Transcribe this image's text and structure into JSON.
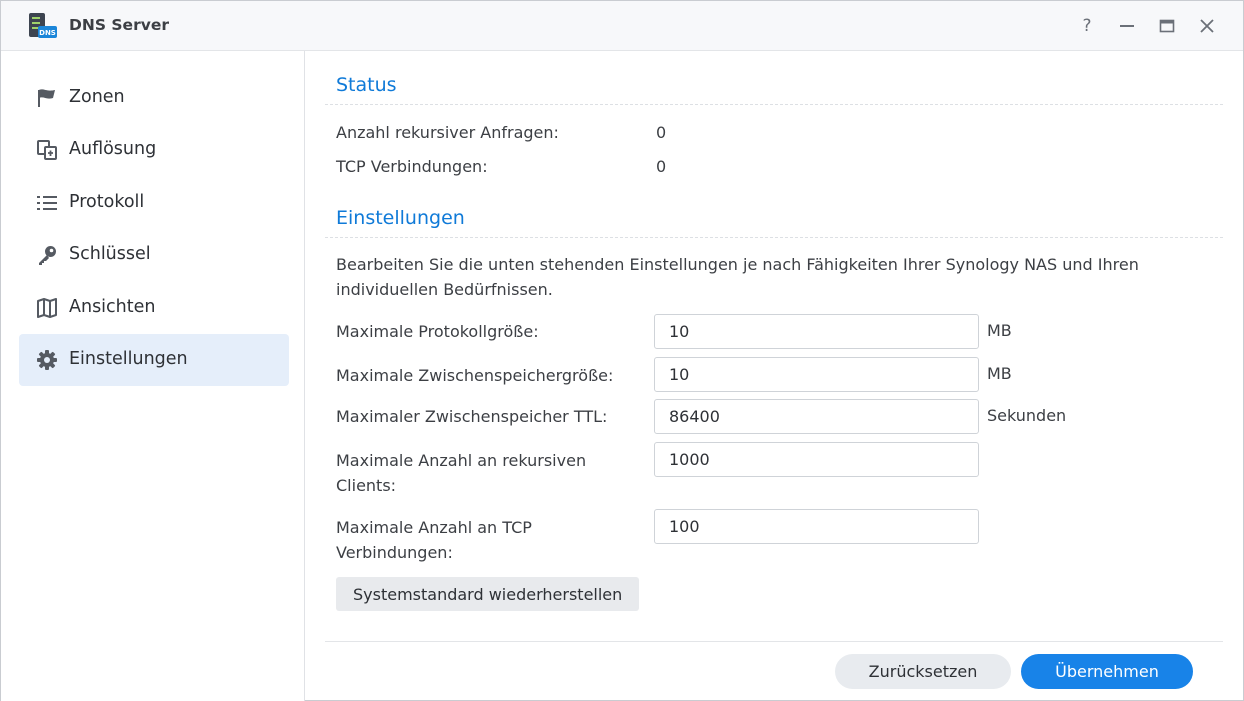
{
  "window": {
    "title": "DNS Server"
  },
  "titlebar": {
    "help_glyph": "?"
  },
  "sidebar": {
    "items": [
      {
        "label": "Zonen",
        "icon": "flag-icon",
        "active": false
      },
      {
        "label": "Auflösung",
        "icon": "resolution-icon",
        "active": false
      },
      {
        "label": "Protokoll",
        "icon": "list-icon",
        "active": false
      },
      {
        "label": "Schlüssel",
        "icon": "key-icon",
        "active": false
      },
      {
        "label": "Ansichten",
        "icon": "map-icon",
        "active": false
      },
      {
        "label": "Einstellungen",
        "icon": "gear-icon",
        "active": true
      }
    ]
  },
  "status": {
    "title": "Status",
    "rows": [
      {
        "label": "Anzahl rekursiver Anfragen:",
        "value": "0"
      },
      {
        "label": "TCP Verbindungen:",
        "value": "0"
      }
    ]
  },
  "settings": {
    "title": "Einstellungen",
    "description": "Bearbeiten Sie die unten stehenden Einstellungen je nach Fähigkeiten Ihrer Synology NAS und Ihren individuellen Bedürfnissen.",
    "fields": [
      {
        "label": "Maximale Protokollgröße:",
        "value": "10",
        "unit": "MB"
      },
      {
        "label": "Maximale Zwischenspeichergröße:",
        "value": "10",
        "unit": "MB"
      },
      {
        "label": "Maximaler Zwischenspeicher TTL:",
        "value": "86400",
        "unit": "Sekunden"
      },
      {
        "label": "Maximale Anzahl an rekursiven Clients:",
        "value": "1000",
        "unit": ""
      },
      {
        "label": "Maximale Anzahl an TCP Verbindungen:",
        "value": "100",
        "unit": ""
      }
    ],
    "restore_label": "Systemstandard wiederherstellen"
  },
  "footer": {
    "reset_label": "Zurücksetzen",
    "apply_label": "Übernehmen"
  },
  "colors": {
    "accent": "#1883e8",
    "section_title": "#0f7ad8",
    "active_nav": "#e5eefa"
  }
}
